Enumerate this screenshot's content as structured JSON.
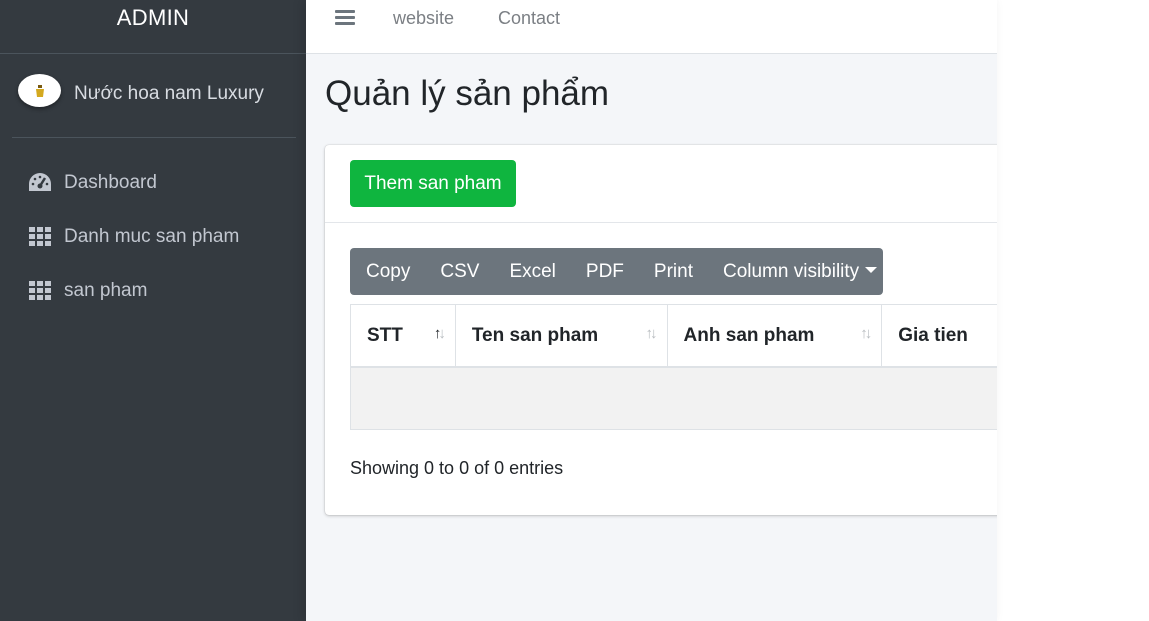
{
  "brand": {
    "title": "ADMIN"
  },
  "user": {
    "name": "Nước hoa nam Luxury",
    "avatar_icon": "perfume-logo-icon"
  },
  "sidebar": {
    "items": [
      {
        "label": "Dashboard",
        "icon": "tachometer-icon"
      },
      {
        "label": "Danh muc san pham",
        "icon": "grid-icon"
      },
      {
        "label": "san pham",
        "icon": "grid-icon"
      }
    ]
  },
  "topbar": {
    "menu_icon": "hamburger-icon",
    "links": [
      "website",
      "Contact"
    ]
  },
  "page": {
    "title": "Quản lý sản phẩm"
  },
  "card": {
    "add_button": "Them san pham",
    "export_buttons": [
      "Copy",
      "CSV",
      "Excel",
      "PDF",
      "Print",
      "Column visibility"
    ],
    "table": {
      "columns": [
        "STT",
        "Ten san pham",
        "Anh san pham",
        "Gia tien"
      ],
      "rows": []
    },
    "info": "Showing 0 to 0 of 0 entries"
  },
  "colors": {
    "sidebar_bg": "#343a40",
    "add_button_bg": "#0fb53f",
    "export_group_bg": "#6c757d",
    "content_bg": "#f4f6f9"
  }
}
